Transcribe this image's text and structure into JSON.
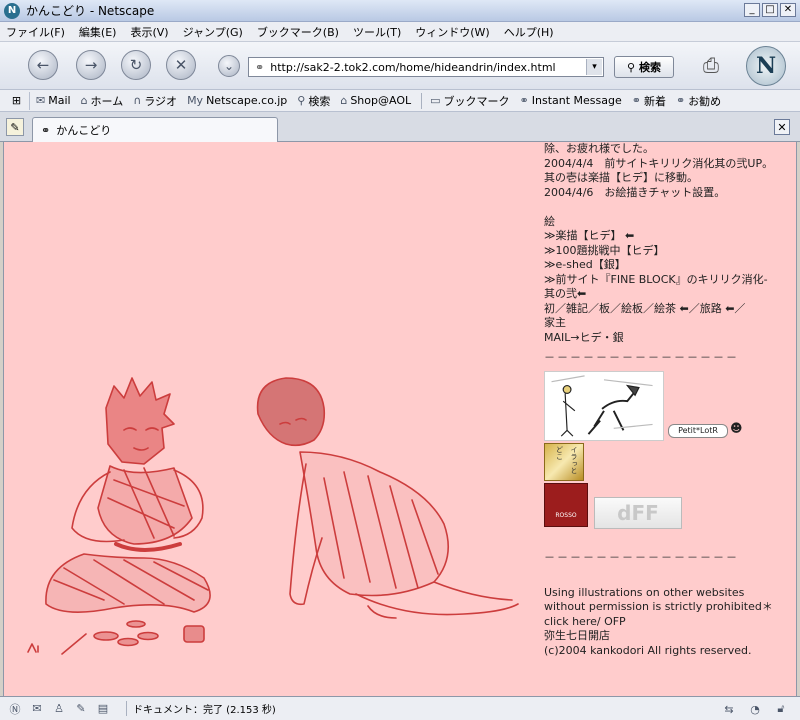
{
  "window": {
    "title": "かんこどり - Netscape",
    "app_icon_glyph": "N",
    "minimize": "_",
    "maximize": "□",
    "close": "✕"
  },
  "menu": [
    "ファイル(F)",
    "編集(E)",
    "表示(V)",
    "ジャンプ(G)",
    "ブックマーク(B)",
    "ツール(T)",
    "ウィンドウ(W)",
    "ヘルプ(H)"
  ],
  "nav": {
    "url": "http://sak2-2.tok2.com/home/hideandrin/index.html",
    "search_label": "検索",
    "logo_glyph": "N"
  },
  "personal_toolbar": [
    {
      "icon": "mail-icon",
      "glyph": "✉",
      "label": "Mail"
    },
    {
      "icon": "home-icon",
      "glyph": "⌂",
      "label": "ホーム"
    },
    {
      "icon": "radio-icon",
      "glyph": "∩",
      "label": "ラジオ"
    },
    {
      "icon": "my-netscape-icon",
      "glyph": "My",
      "label": "Netscape.co.jp"
    },
    {
      "icon": "search-icon",
      "glyph": "⚲",
      "label": "検索"
    },
    {
      "icon": "shop-icon",
      "glyph": "⌂",
      "label": "Shop@AOL"
    },
    {
      "icon": "bookmark-folder-icon",
      "glyph": "▭",
      "label": "ブックマーク"
    },
    {
      "icon": "link-icon",
      "glyph": "⚭",
      "label": "Instant Message"
    },
    {
      "icon": "link-icon",
      "glyph": "⚭",
      "label": "新着"
    },
    {
      "icon": "link-icon",
      "glyph": "⚭",
      "label": "お勧め"
    }
  ],
  "tab": {
    "label": "かんこどり",
    "close": "✕"
  },
  "page": {
    "lines_top": [
      "除、お疲れ様でした。",
      "2004/4/4　前サイトキリリク消化其の弐UP。",
      "其の壱は楽描【ヒデ】に移動。",
      "2004/4/6　お絵描きチャット設置。"
    ],
    "section_title": "絵",
    "links": [
      "≫楽描【ヒデ】 ⬅",
      "≫100題挑戦中【ヒデ】",
      "≫e-shed【銀】",
      "≫前サイト『FINE BLOCK』のキリリク消化-",
      "其の弐⬅"
    ],
    "nav_lines": [
      "初／雑記／板／絵板／絵茶 ⬅／旅路 ⬅／",
      "家主",
      "MAIL→ヒデ・銀"
    ],
    "divider": "－－－－－－－－－－－－－－－",
    "banners": {
      "petit": "Petit*LotR",
      "ira": "イラっとどこ",
      "rosso": "ROSSO",
      "dff": "dFF"
    },
    "footer_lines": [
      "Using illustrations on other websites",
      "without permission is strictly prohibited＊",
      "click here/ OFP",
      "弥生七日開店",
      "(c)2004 kankodori All rights reserved."
    ],
    "bg_color": "#ffcccc",
    "art_color": "#cc3d3d"
  },
  "status": {
    "text": "ドキュメント：完了 (2.153 秒)"
  }
}
